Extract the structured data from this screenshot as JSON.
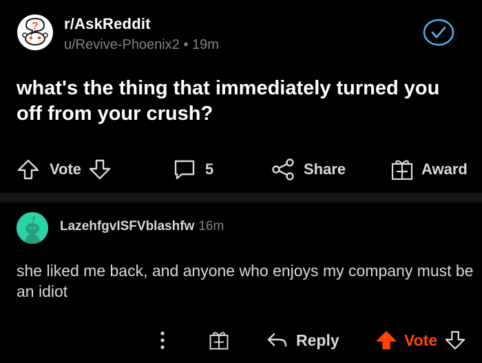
{
  "post": {
    "subreddit": "r/AskReddit",
    "author": "u/Revive-Phoenix2",
    "separator": "•",
    "time": "19m",
    "title": "what's the thing that immediately turned you off from your crush?",
    "actions": {
      "vote_label": "Vote",
      "comment_count": "5",
      "share_label": "Share",
      "award_label": "Award"
    }
  },
  "comment": {
    "username": "LazehfgvISFVblashfw",
    "time": "16m",
    "body": "she liked me back, and anyone who enjoys my company must be an idiot",
    "actions": {
      "more_label": "⋮",
      "reply_label": "Reply",
      "vote_label": "Vote"
    }
  },
  "colors": {
    "background": "#000000",
    "text": "#d7dadc",
    "muted": "#818384",
    "upvote_active": "#ff4500",
    "join_check": "#4fbcff",
    "avatar": "#2bd4a4"
  },
  "icons": {
    "subreddit": "askreddit-snoo-icon",
    "joined": "check-icon",
    "upvote": "arrow-up-icon",
    "downvote": "arrow-down-icon",
    "comments": "comment-bubble-icon",
    "share": "share-icon",
    "award": "gift-icon",
    "reply": "reply-arrow-icon",
    "more": "more-vertical-icon"
  }
}
